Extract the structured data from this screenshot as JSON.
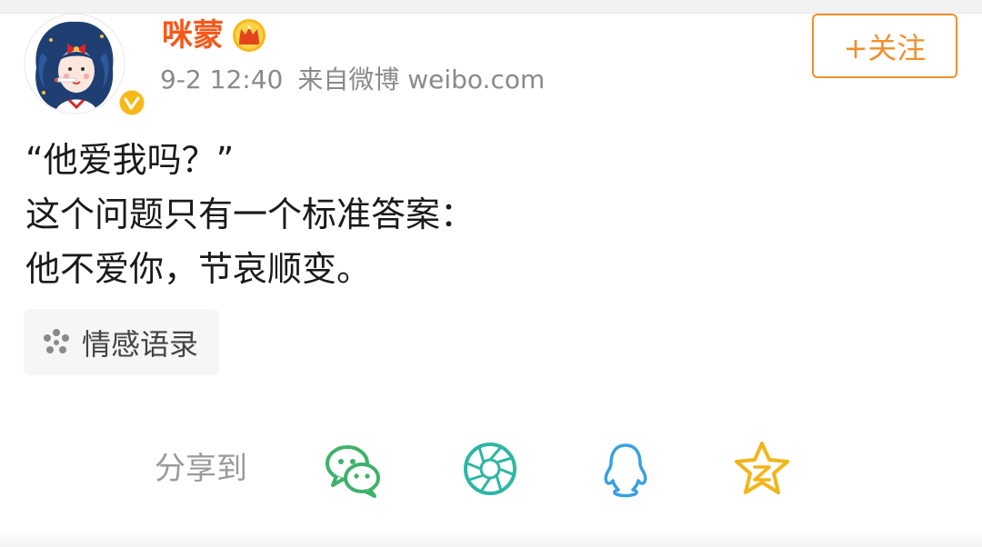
{
  "header": {
    "username": "咪蒙",
    "timestamp": "9-2 12:40",
    "source": "来自微博 weibo.com",
    "follow_label": "+关注",
    "avatar_icon": "avatar-illustration",
    "verified_icon": "verified-v-icon",
    "vip_icon": "crown-icon"
  },
  "post": {
    "lines": [
      "“他爱我吗？”",
      "这个问题只有一个标准答案：",
      "他不爱你，节哀顺变。"
    ],
    "topic": {
      "label": "情感语录",
      "icon": "topic-flower-icon"
    }
  },
  "share": {
    "label": "分享到",
    "targets": [
      {
        "name": "wechat",
        "icon": "wechat-icon",
        "color": "#3fb26a"
      },
      {
        "name": "moments",
        "icon": "moments-icon",
        "color": "#2fb6a4"
      },
      {
        "name": "qq",
        "icon": "qq-icon",
        "color": "#3aa0e0"
      },
      {
        "name": "qzone",
        "icon": "qzone-star-icon",
        "color": "#f2b51a"
      }
    ]
  },
  "colors": {
    "username": "#f6581a",
    "follow": "#f0902d",
    "meta": "#8a8a8a",
    "text": "#1a1a1a"
  }
}
